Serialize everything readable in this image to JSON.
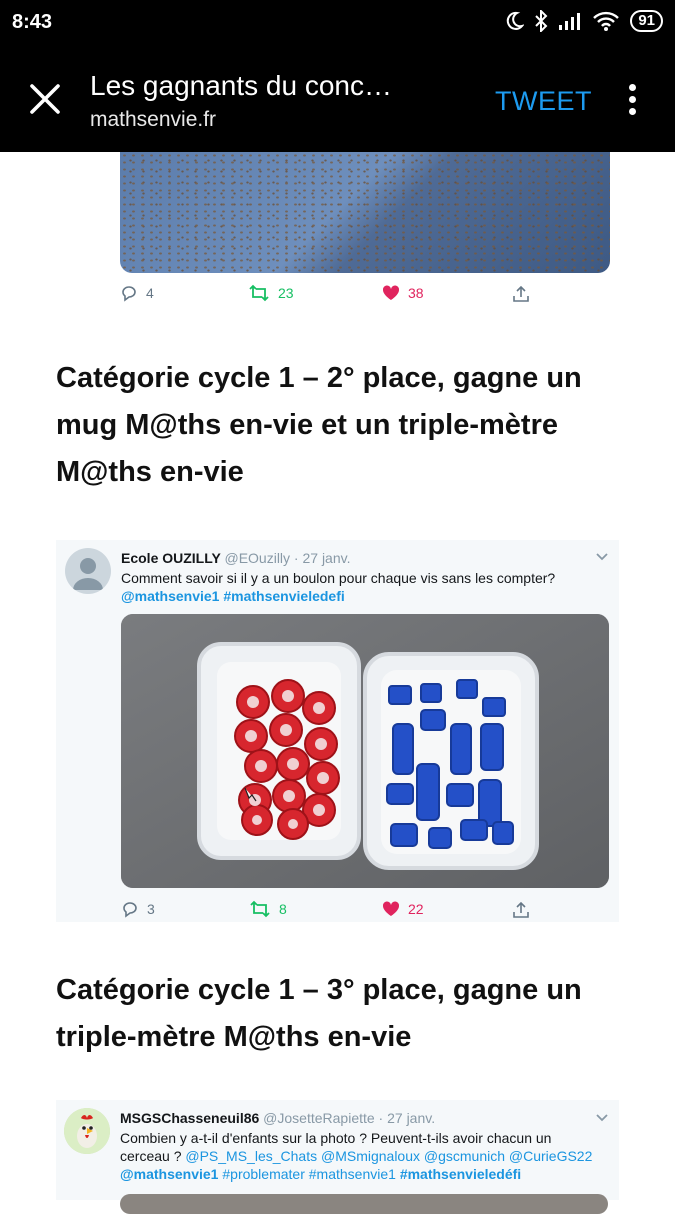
{
  "status": {
    "time": "8:43",
    "battery": "91"
  },
  "header": {
    "title": "Les gagnants du conc…",
    "url": "mathsenvie.fr",
    "tweet_button": "TWEET"
  },
  "first_tweet_actions": {
    "replies": "4",
    "retweets": "23",
    "likes": "38"
  },
  "sections": [
    {
      "heading_lines": [
        "Catégorie cycle 1 – 2° place, gagne un",
        "mug M@ths en-vie et un triple-mètre",
        "M@ths en-vie"
      ],
      "tweet": {
        "name": "Ecole OUZILLY",
        "handle_date": "@EOuzilly · 27 janv.",
        "text": "Comment savoir si il y a un boulon pour chaque vis sans les compter?",
        "tags": [
          "@mathsenvie1",
          "#mathsenvieledefi"
        ],
        "replies": "3",
        "retweets": "8",
        "likes": "22"
      }
    },
    {
      "heading_lines": [
        "Catégorie cycle 1 – 3° place, gagne un",
        "triple-mètre M@ths en-vie"
      ],
      "tweet": {
        "name": "MSGSChasseneuil86",
        "handle_date": "@JosetteRapiette · 27 janv.",
        "text_line1": "Combien y a-t-il d'enfants sur la photo ? Peuvent-t-ils avoir chacun un",
        "text_line2_plain": "cerceau ? ",
        "mentions": "@PS_MS_les_Chats @MSmignaloux @gscmunich @CurieGS22",
        "tag1": "@mathsenvie1",
        "tag2": "#problemater #mathsenvie1",
        "tag3": "#mathsenvieledéfi"
      }
    }
  ],
  "colors": {
    "accent": "#1d9bf0",
    "retweet": "#17bf63",
    "like": "#e0245e",
    "icon": "#657786"
  }
}
